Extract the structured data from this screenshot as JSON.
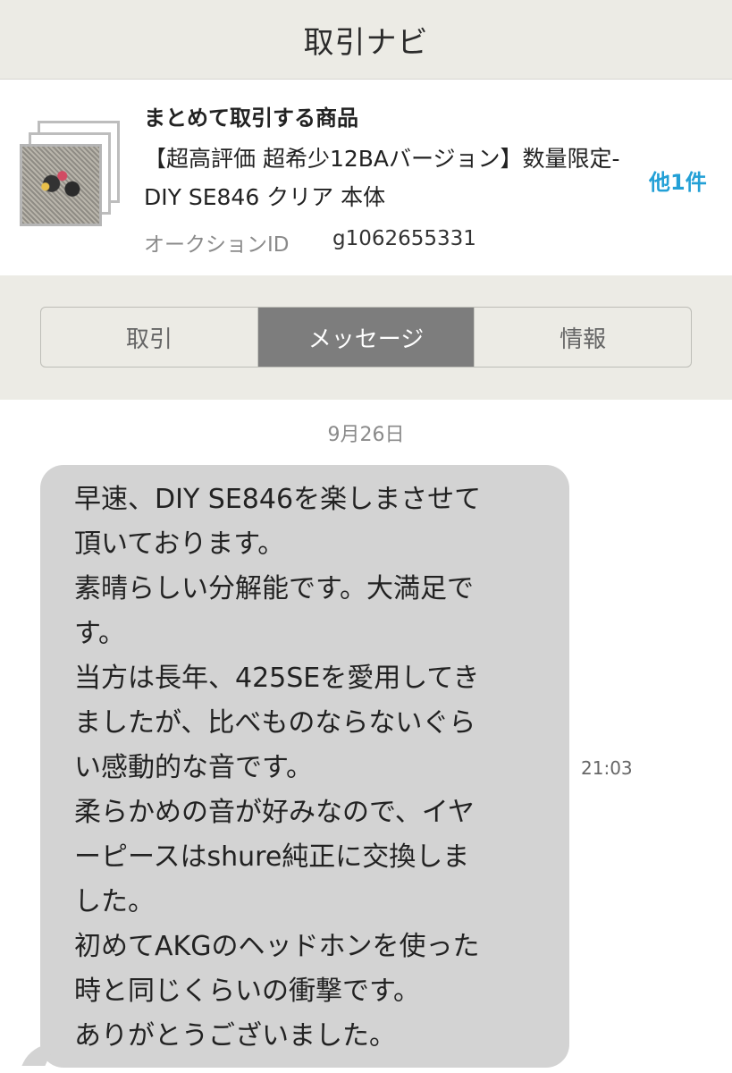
{
  "header": {
    "title": "取引ナビ"
  },
  "item": {
    "section_label": "まとめて取引する商品",
    "title": "【超高評価 超希少12BAバージョン】数量限定-DIY SE846 クリア 本体",
    "other_count": "他1件",
    "auction_label": "オークションID",
    "auction_id": "g1062655331",
    "thumbnail_icon": "product-thumbnail-stack"
  },
  "tabs": [
    {
      "label": "取引",
      "active": false
    },
    {
      "label": "メッセージ",
      "active": true
    },
    {
      "label": "情報",
      "active": false
    }
  ],
  "chat": {
    "date": "9月26日",
    "message": {
      "lines": [
        "早速、DIY SE846を楽しまさせて",
        "頂いております。",
        "素晴らしい分解能です。大満足で",
        "す。",
        "当方は長年、425SEを愛用してき",
        "ましたが、比べものならないぐら",
        "い感動的な音です。",
        "柔らかめの音が好みなので、イヤ",
        "ーピースはshure純正に交換しま",
        "した。",
        "初めてAKGのヘッドホンを使った",
        "時と同じくらいの衝撃です。",
        "ありがとうございました。"
      ],
      "time": "21:03"
    }
  },
  "colors": {
    "accent": "#23a0d6",
    "active_tab": "#7d7d7d",
    "bubble": "#d3d3d3",
    "panel_bg": "#ecebe5"
  }
}
